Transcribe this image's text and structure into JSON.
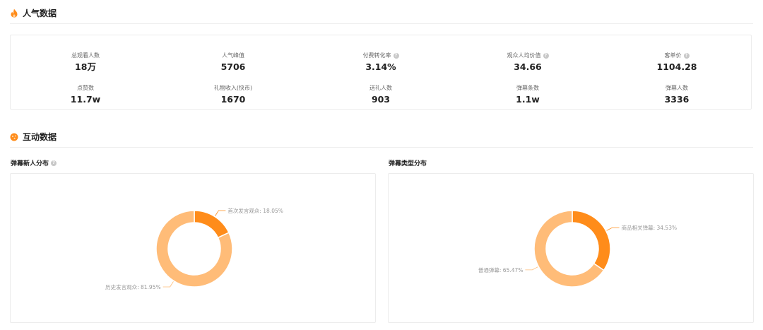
{
  "popularity": {
    "title": "人气数据",
    "stats": [
      {
        "label": "总观看人数",
        "value": "18万",
        "info": false
      },
      {
        "label": "人气峰值",
        "value": "5706",
        "info": false
      },
      {
        "label": "付费转化率",
        "value": "3.14%",
        "info": true
      },
      {
        "label": "观众人均价值",
        "value": "34.66",
        "info": true
      },
      {
        "label": "客单价",
        "value": "1104.28",
        "info": true
      },
      {
        "label": "点赞数",
        "value": "11.7w",
        "info": false
      },
      {
        "label": "礼物收入(快币)",
        "value": "1670",
        "info": false
      },
      {
        "label": "送礼人数",
        "value": "903",
        "info": false
      },
      {
        "label": "弹幕条数",
        "value": "1.1w",
        "info": false
      },
      {
        "label": "弹幕人数",
        "value": "3336",
        "info": false
      }
    ]
  },
  "interaction": {
    "title": "互动数据",
    "charts": [
      {
        "title": "弹幕新人分布",
        "info": true,
        "chart_data": {
          "type": "pie",
          "slices": [
            {
              "label": "首次发言观众",
              "value": 18.05,
              "color": "#FF8C1A"
            },
            {
              "label": "历史发言观众",
              "value": 81.95,
              "color": "#FFBC78"
            }
          ]
        }
      },
      {
        "title": "弹幕类型分布",
        "info": false,
        "chart_data": {
          "type": "pie",
          "slices": [
            {
              "label": "商品相关弹幕",
              "value": 34.53,
              "color": "#FF8C1A"
            },
            {
              "label": "普通弹幕",
              "value": 65.47,
              "color": "#FFBC78"
            }
          ]
        }
      }
    ]
  },
  "colors": {
    "accent": "#FF8C1A",
    "muted": "#FFBC78",
    "label_text": "#999999"
  },
  "icons": {
    "popularity": "fire-icon",
    "interaction": "interaction-dot-icon",
    "info": "info-icon"
  }
}
